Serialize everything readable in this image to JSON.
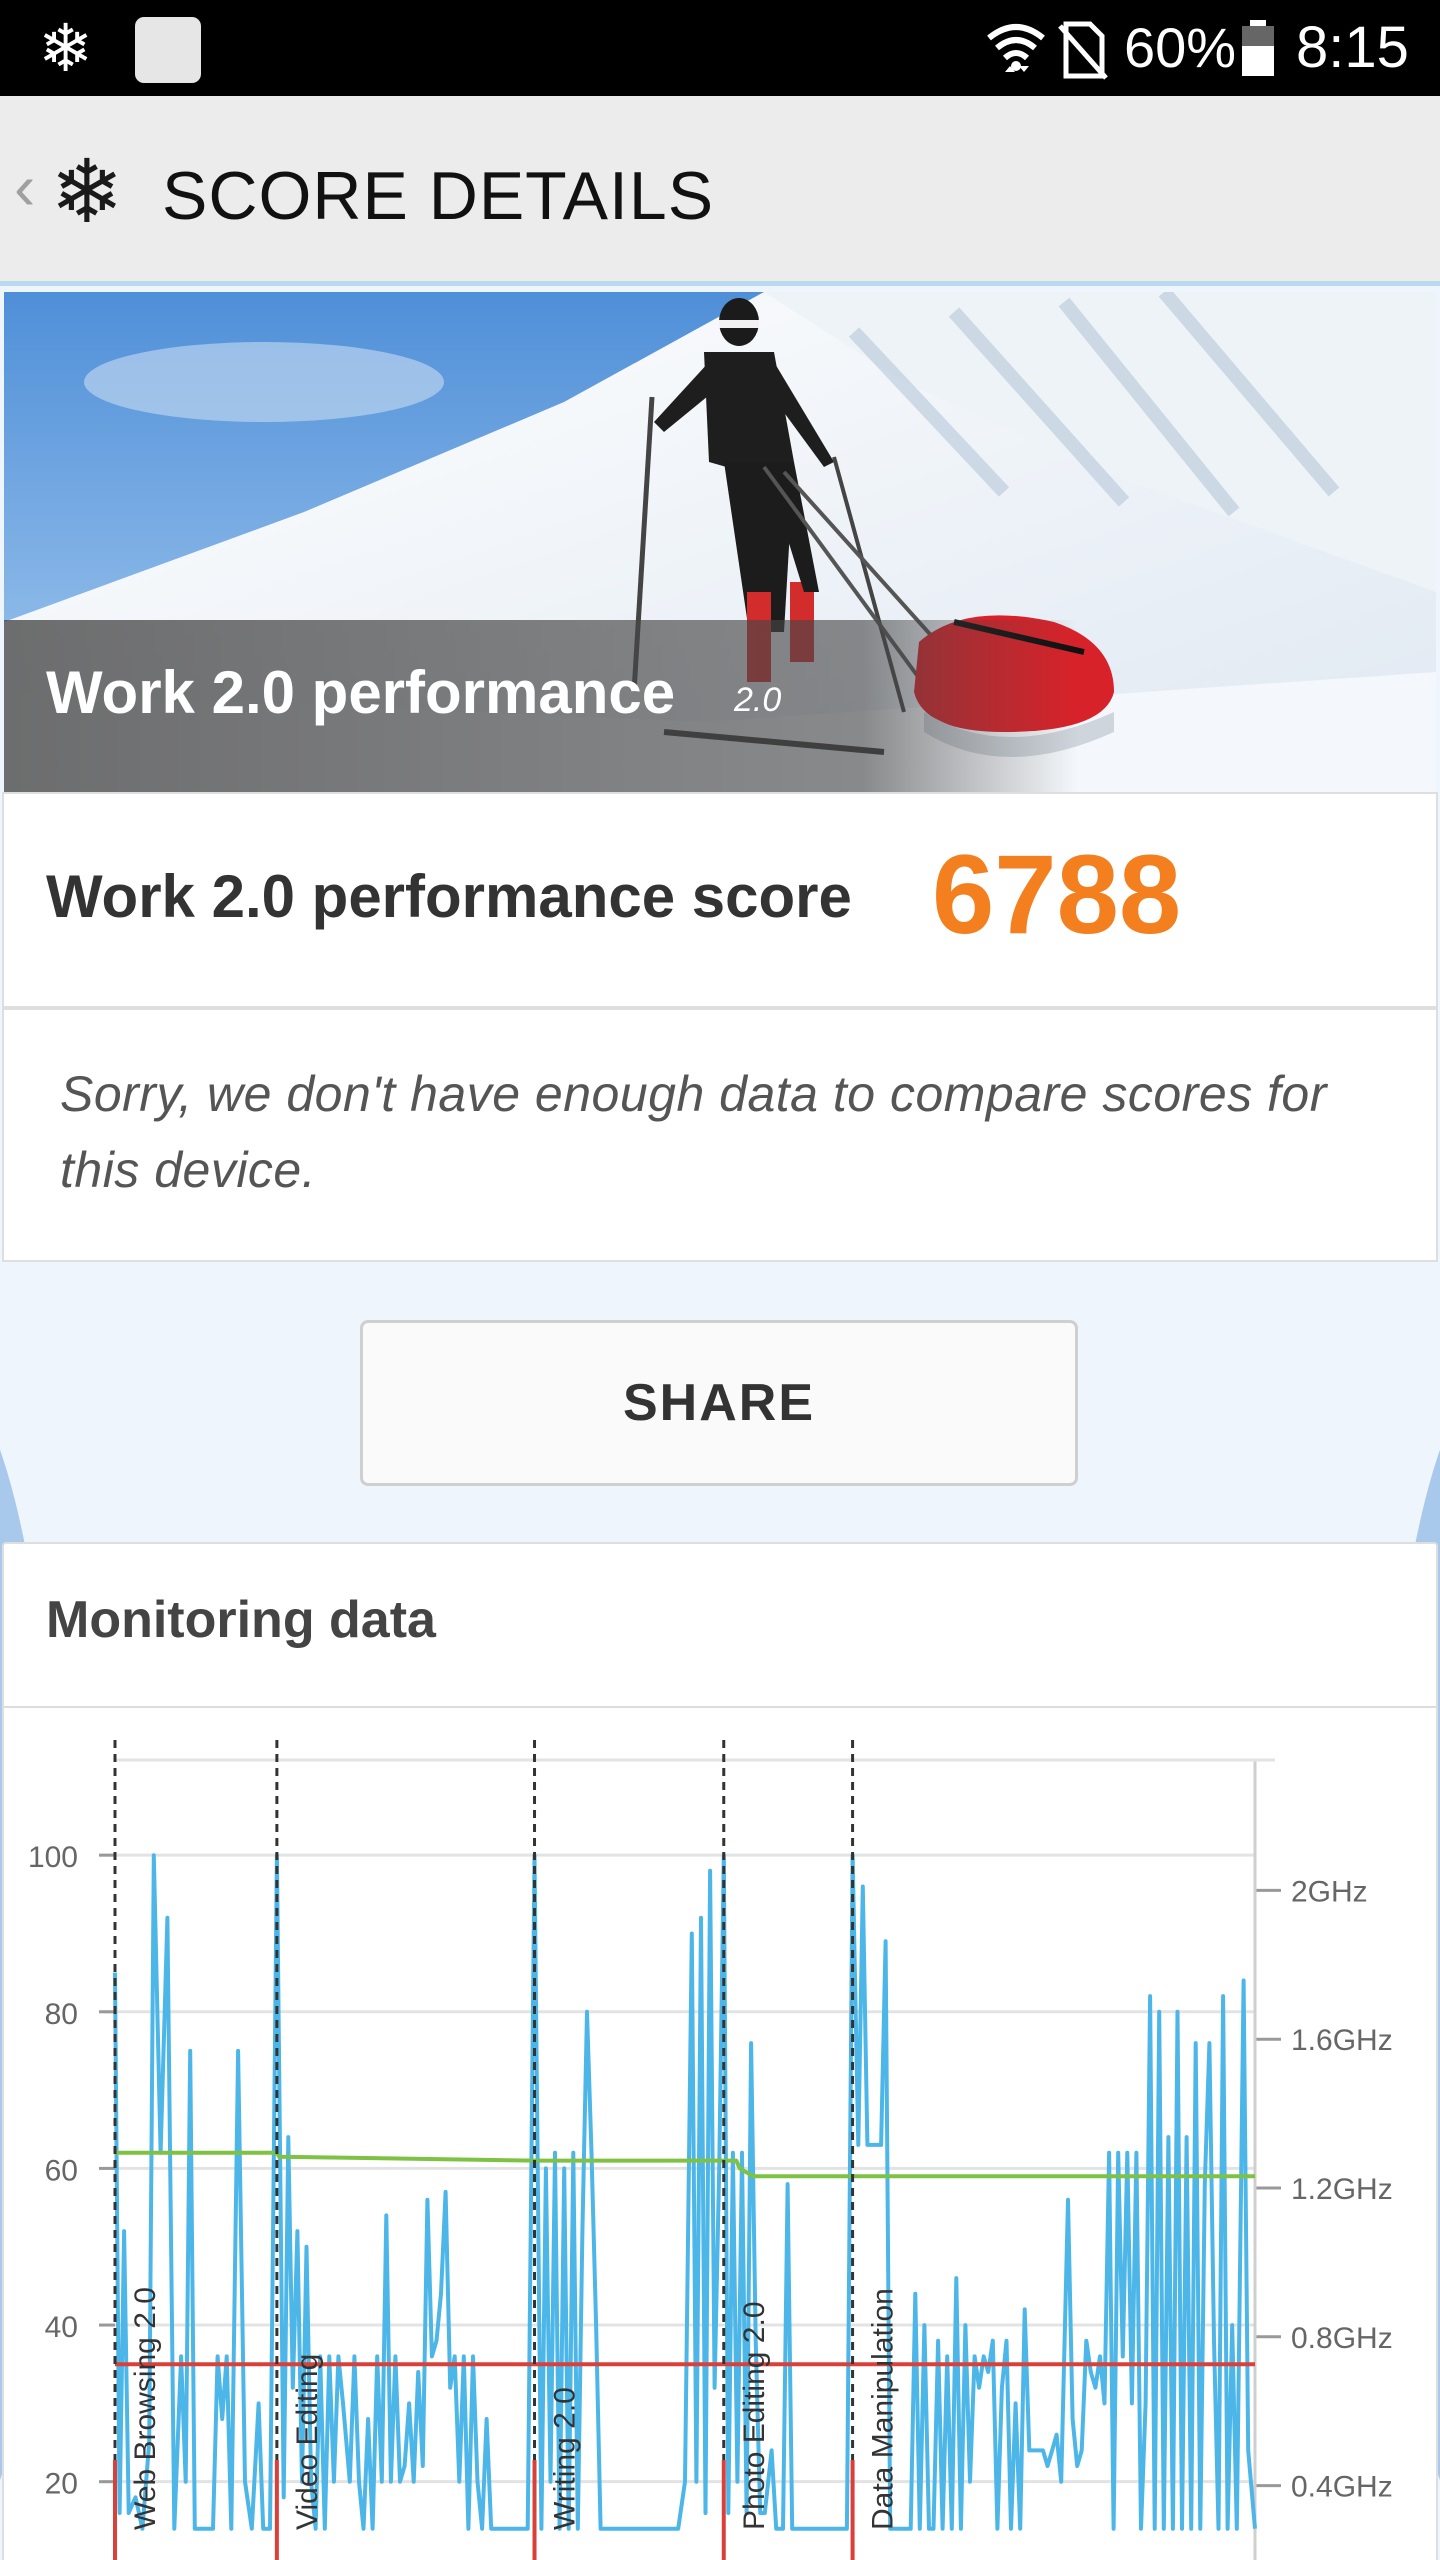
{
  "status_bar": {
    "battery_percent": "60%",
    "time": "8:15",
    "icons": [
      "snowflake-icon",
      "app-square-icon",
      "wifi-icon",
      "no-sim-icon",
      "battery-icon"
    ]
  },
  "app_bar": {
    "back_glyph": "‹",
    "logo_glyph": "❄",
    "title": "SCORE DETAILS"
  },
  "hero": {
    "title": "Work 2.0 performance",
    "version": "2.0"
  },
  "score": {
    "label": "Work 2.0 performance score",
    "value": "6788",
    "value_color": "#f37f1f"
  },
  "compare": {
    "message": "Sorry, we don't have enough data to compare scores for this device."
  },
  "share": {
    "label": "SHARE"
  },
  "monitoring": {
    "heading": "Monitoring data"
  },
  "chart_data": {
    "type": "line",
    "y_left_ticks": [
      "20",
      "40",
      "60",
      "80",
      "100"
    ],
    "y_right_ticks": [
      "0.4GHz",
      "0.8GHz",
      "1.2GHz",
      "1.6GHz",
      "2GHz"
    ],
    "ylim_left": [
      10,
      105
    ],
    "ylim_right": [
      0.2,
      2.2
    ],
    "grid": true,
    "sections": [
      {
        "label": "Web Browsing 2.0",
        "x": 0.0
      },
      {
        "label": "Video Editing",
        "x": 0.142
      },
      {
        "label": "Writing 2.0",
        "x": 0.368
      },
      {
        "label": "Photo Editing 2.0",
        "x": 0.534
      },
      {
        "label": "Data Manipulation",
        "x": 0.647
      }
    ],
    "x_end": 1.0,
    "series": [
      {
        "color": "#4db6e8",
        "values": [
          [
            0.0,
            85
          ],
          [
            0.004,
            16
          ],
          [
            0.008,
            52
          ],
          [
            0.012,
            16
          ],
          [
            0.018,
            18
          ],
          [
            0.024,
            14
          ],
          [
            0.03,
            25
          ],
          [
            0.034,
            100
          ],
          [
            0.04,
            62
          ],
          [
            0.046,
            92
          ],
          [
            0.052,
            14
          ],
          [
            0.058,
            36
          ],
          [
            0.062,
            20
          ],
          [
            0.066,
            75
          ],
          [
            0.07,
            14
          ],
          [
            0.078,
            14
          ],
          [
            0.086,
            14
          ],
          [
            0.09,
            36
          ],
          [
            0.094,
            28
          ],
          [
            0.098,
            36
          ],
          [
            0.102,
            14
          ],
          [
            0.108,
            75
          ],
          [
            0.114,
            20
          ],
          [
            0.12,
            14
          ],
          [
            0.126,
            30
          ],
          [
            0.13,
            14
          ],
          [
            0.136,
            14
          ],
          [
            0.142,
            100
          ],
          [
            0.148,
            18
          ],
          [
            0.152,
            64
          ],
          [
            0.156,
            32
          ],
          [
            0.16,
            52
          ],
          [
            0.164,
            20
          ],
          [
            0.168,
            50
          ],
          [
            0.172,
            20
          ],
          [
            0.176,
            14
          ],
          [
            0.18,
            36
          ],
          [
            0.184,
            14
          ],
          [
            0.188,
            36
          ],
          [
            0.192,
            20
          ],
          [
            0.196,
            36
          ],
          [
            0.2,
            30
          ],
          [
            0.206,
            20
          ],
          [
            0.21,
            36
          ],
          [
            0.214,
            20
          ],
          [
            0.218,
            14
          ],
          [
            0.222,
            28
          ],
          [
            0.226,
            14
          ],
          [
            0.23,
            36
          ],
          [
            0.234,
            20
          ],
          [
            0.238,
            54
          ],
          [
            0.242,
            20
          ],
          [
            0.246,
            36
          ],
          [
            0.25,
            20
          ],
          [
            0.254,
            22
          ],
          [
            0.258,
            30
          ],
          [
            0.262,
            20
          ],
          [
            0.266,
            34
          ],
          [
            0.27,
            22
          ],
          [
            0.274,
            56
          ],
          [
            0.278,
            36
          ],
          [
            0.282,
            38
          ],
          [
            0.286,
            44
          ],
          [
            0.29,
            57
          ],
          [
            0.294,
            32
          ],
          [
            0.298,
            36
          ],
          [
            0.302,
            20
          ],
          [
            0.306,
            36
          ],
          [
            0.31,
            14
          ],
          [
            0.314,
            36
          ],
          [
            0.318,
            20
          ],
          [
            0.322,
            14
          ],
          [
            0.326,
            28
          ],
          [
            0.33,
            14
          ],
          [
            0.338,
            14
          ],
          [
            0.346,
            14
          ],
          [
            0.354,
            14
          ],
          [
            0.362,
            14
          ],
          [
            0.368,
            100
          ],
          [
            0.374,
            14
          ],
          [
            0.378,
            60
          ],
          [
            0.382,
            20
          ],
          [
            0.386,
            62
          ],
          [
            0.39,
            14
          ],
          [
            0.394,
            60
          ],
          [
            0.398,
            14
          ],
          [
            0.402,
            62
          ],
          [
            0.406,
            14
          ],
          [
            0.41,
            52
          ],
          [
            0.414,
            80
          ],
          [
            0.418,
            62
          ],
          [
            0.422,
            40
          ],
          [
            0.426,
            14
          ],
          [
            0.434,
            14
          ],
          [
            0.442,
            14
          ],
          [
            0.45,
            14
          ],
          [
            0.458,
            14
          ],
          [
            0.466,
            14
          ],
          [
            0.474,
            14
          ],
          [
            0.482,
            14
          ],
          [
            0.488,
            14
          ],
          [
            0.494,
            14
          ],
          [
            0.5,
            20
          ],
          [
            0.506,
            90
          ],
          [
            0.51,
            20
          ],
          [
            0.514,
            92
          ],
          [
            0.518,
            16
          ],
          [
            0.522,
            98
          ],
          [
            0.526,
            32
          ],
          [
            0.53,
            60
          ],
          [
            0.534,
            100
          ],
          [
            0.538,
            16
          ],
          [
            0.542,
            62
          ],
          [
            0.546,
            20
          ],
          [
            0.55,
            62
          ],
          [
            0.554,
            16
          ],
          [
            0.558,
            76
          ],
          [
            0.562,
            38
          ],
          [
            0.566,
            16
          ],
          [
            0.57,
            16
          ],
          [
            0.576,
            24
          ],
          [
            0.58,
            14
          ],
          [
            0.586,
            14
          ],
          [
            0.59,
            58
          ],
          [
            0.594,
            14
          ],
          [
            0.6,
            14
          ],
          [
            0.606,
            14
          ],
          [
            0.612,
            14
          ],
          [
            0.618,
            14
          ],
          [
            0.624,
            14
          ],
          [
            0.63,
            14
          ],
          [
            0.636,
            14
          ],
          [
            0.642,
            14
          ],
          [
            0.647,
            100
          ],
          [
            0.652,
            63
          ],
          [
            0.656,
            96
          ],
          [
            0.66,
            63
          ],
          [
            0.666,
            63
          ],
          [
            0.672,
            63
          ],
          [
            0.676,
            89
          ],
          [
            0.68,
            14
          ],
          [
            0.686,
            14
          ],
          [
            0.692,
            14
          ],
          [
            0.698,
            14
          ],
          [
            0.702,
            44
          ],
          [
            0.706,
            14
          ],
          [
            0.71,
            40
          ],
          [
            0.714,
            14
          ],
          [
            0.718,
            14
          ],
          [
            0.722,
            38
          ],
          [
            0.726,
            14
          ],
          [
            0.73,
            36
          ],
          [
            0.734,
            14
          ],
          [
            0.738,
            46
          ],
          [
            0.742,
            14
          ],
          [
            0.746,
            40
          ],
          [
            0.75,
            20
          ],
          [
            0.754,
            36
          ],
          [
            0.758,
            32
          ],
          [
            0.762,
            36
          ],
          [
            0.766,
            34
          ],
          [
            0.77,
            38
          ],
          [
            0.774,
            14
          ],
          [
            0.778,
            32
          ],
          [
            0.782,
            38
          ],
          [
            0.786,
            14
          ],
          [
            0.79,
            30
          ],
          [
            0.794,
            14
          ],
          [
            0.798,
            42
          ],
          [
            0.802,
            24
          ],
          [
            0.806,
            24
          ],
          [
            0.81,
            24
          ],
          [
            0.814,
            24
          ],
          [
            0.818,
            22
          ],
          [
            0.822,
            24
          ],
          [
            0.826,
            26
          ],
          [
            0.83,
            20
          ],
          [
            0.836,
            56
          ],
          [
            0.84,
            28
          ],
          [
            0.844,
            22
          ],
          [
            0.848,
            24
          ],
          [
            0.852,
            38
          ],
          [
            0.856,
            34
          ],
          [
            0.86,
            32
          ],
          [
            0.864,
            36
          ],
          [
            0.868,
            30
          ],
          [
            0.872,
            62
          ],
          [
            0.876,
            14
          ],
          [
            0.88,
            62
          ],
          [
            0.884,
            36
          ],
          [
            0.888,
            62
          ],
          [
            0.892,
            30
          ],
          [
            0.896,
            62
          ],
          [
            0.9,
            14
          ],
          [
            0.904,
            30
          ],
          [
            0.908,
            82
          ],
          [
            0.912,
            14
          ],
          [
            0.916,
            80
          ],
          [
            0.92,
            14
          ],
          [
            0.924,
            64
          ],
          [
            0.928,
            14
          ],
          [
            0.932,
            80
          ],
          [
            0.936,
            14
          ],
          [
            0.94,
            64
          ],
          [
            0.944,
            14
          ],
          [
            0.948,
            76
          ],
          [
            0.952,
            14
          ],
          [
            0.956,
            58
          ],
          [
            0.96,
            76
          ],
          [
            0.964,
            38
          ],
          [
            0.968,
            14
          ],
          [
            0.972,
            82
          ],
          [
            0.976,
            14
          ],
          [
            0.98,
            40
          ],
          [
            0.984,
            14
          ],
          [
            0.99,
            84
          ],
          [
            0.994,
            24
          ],
          [
            1.0,
            14
          ]
        ]
      },
      {
        "color": "#7dc242",
        "values": [
          [
            0.0,
            62
          ],
          [
            0.142,
            62
          ],
          [
            0.144,
            61.5
          ],
          [
            0.368,
            61
          ],
          [
            0.534,
            61
          ],
          [
            0.545,
            61
          ],
          [
            0.548,
            60
          ],
          [
            0.56,
            59
          ],
          [
            1.0,
            59
          ]
        ]
      },
      {
        "color": "#d9403a",
        "values": [
          [
            0.0,
            35
          ],
          [
            1.0,
            35
          ]
        ]
      }
    ]
  }
}
